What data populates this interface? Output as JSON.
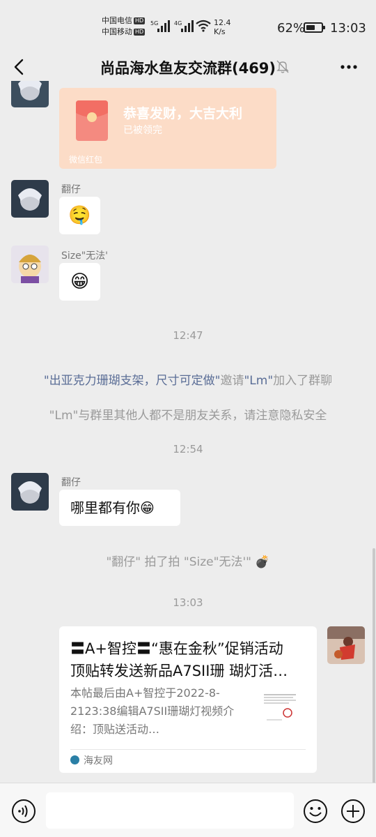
{
  "status_bar": {
    "carrier1": "中国电信",
    "carrier2": "中国移动",
    "hd": "HD",
    "net1": "5G",
    "net2": "4G",
    "speed_value": "12.4",
    "speed_unit": "K/s",
    "battery_percent": "62%",
    "battery_level": 0.62,
    "time": "13:03"
  },
  "header": {
    "title": "尚品海水鱼友交流群(469)",
    "icons": [
      "back-icon",
      "mute-bell-icon",
      "more-icon"
    ]
  },
  "messages": {
    "red_packet": {
      "title": "恭喜发财，大吉大利",
      "status": "已被领完",
      "footer": "微信红包"
    },
    "m1": {
      "sender": "翻仔",
      "emoji": "🤤"
    },
    "m2": {
      "sender": "Size\"无法'",
      "emoji": "😁"
    },
    "time1": "12:47",
    "sys1": {
      "inviter": "\"出亚克力珊瑚支架，尺寸可定做\"",
      "mid": "邀请",
      "invitee": "\"Lm\"",
      "tail": "加入了群聊"
    },
    "sys2": "\"Lm\"与群里其他人都不是朋友关系，请注意隐私安全",
    "time2": "12:54",
    "m3": {
      "sender": "翻仔",
      "text": "哪里都有你😁"
    },
    "sys3": "\"翻仔\" 拍了拍 \"Size\"无法'\" 💣",
    "time3": "13:03",
    "card": {
      "title_line1": "〓A+智控〓“惠在金秋”促销活动",
      "title_line2": "顶贴转发送新品A7SII珊 瑚灯活…",
      "desc": "本帖最后由A+智控于2022-8-2123:38编辑A7SII珊瑚灯视频介绍：顶贴送活动…",
      "source": "海友网"
    }
  },
  "input_bar": {
    "icons": [
      "voice-icon",
      "emoji-icon",
      "plus-icon"
    ]
  },
  "colors": {
    "background": "#ededed",
    "red_packet_bg": "#fcdcc7",
    "link_name": "#5a6d96",
    "system_text": "#9a9a9a"
  }
}
